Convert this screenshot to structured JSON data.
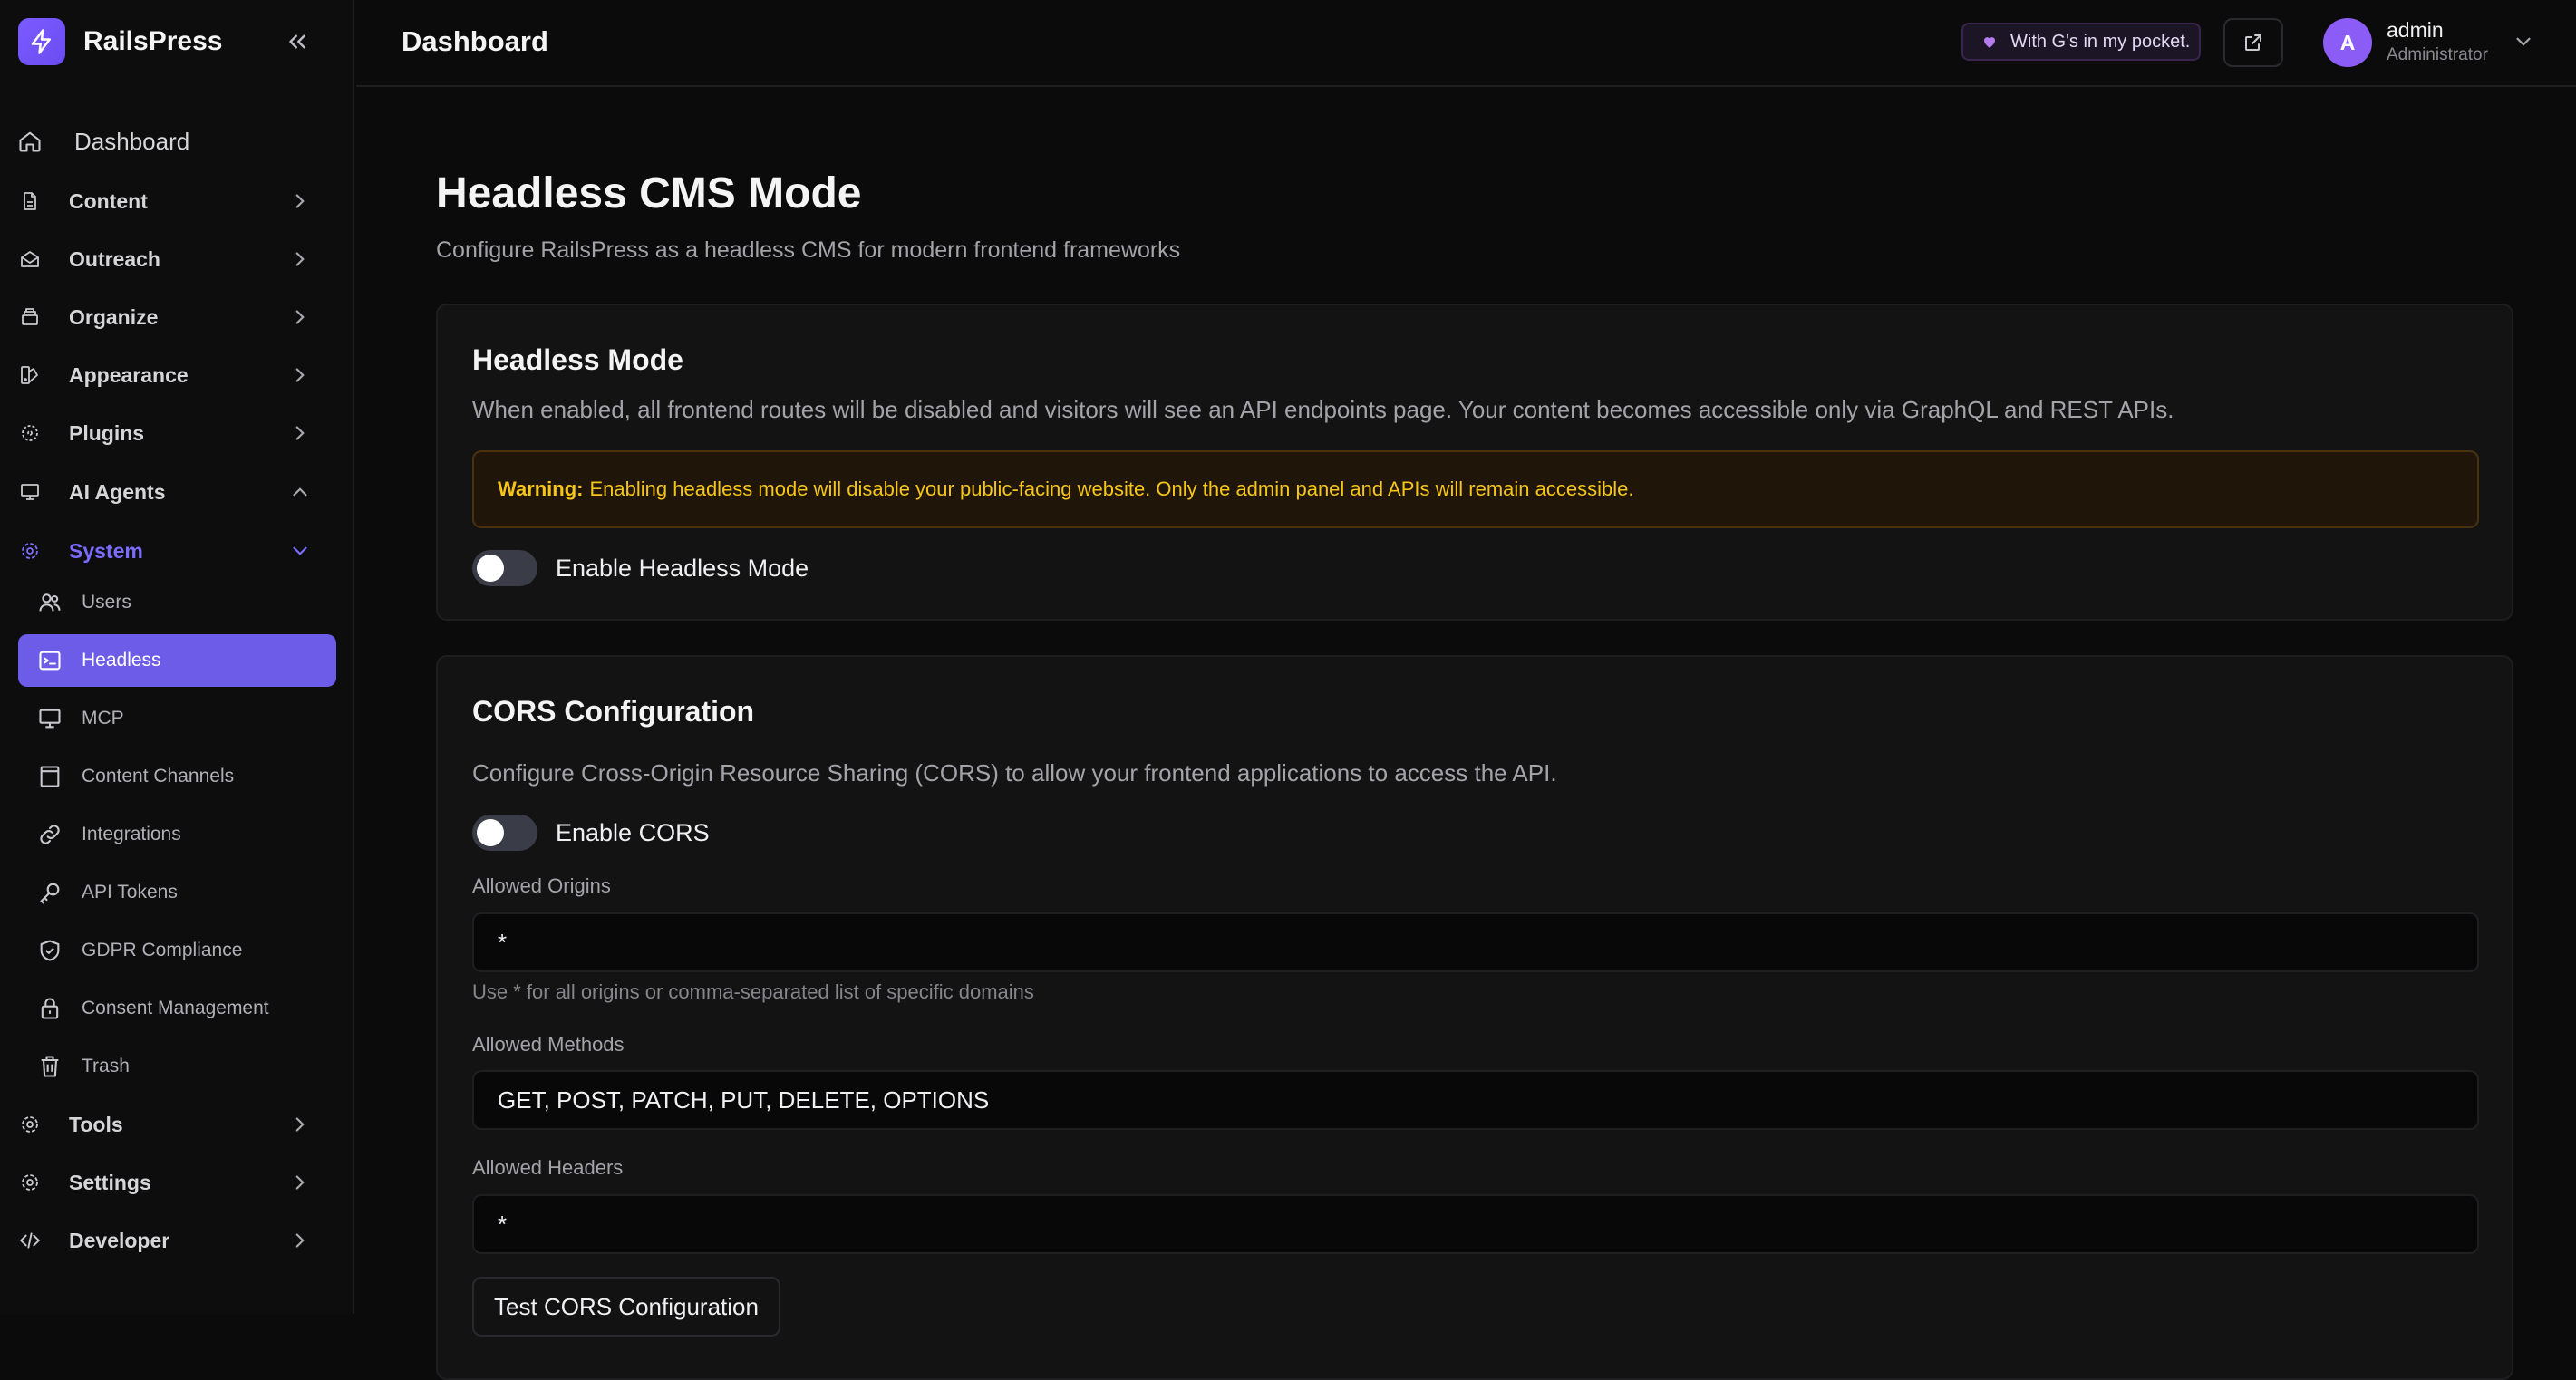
{
  "colors": {
    "accent": "#6c5ce7",
    "system_accent": "#7b6cff",
    "warning_text": "#f5c518",
    "avatar": "#8b5cf6"
  },
  "brand": {
    "name": "RailsPress",
    "logo_icon": "bolt-icon"
  },
  "sidebar": {
    "dashboard": "Dashboard",
    "items": [
      {
        "label": "Content",
        "icon": "file-icon",
        "expanded": false
      },
      {
        "label": "Outreach",
        "icon": "mail-open-icon",
        "expanded": false
      },
      {
        "label": "Organize",
        "icon": "archive-icon",
        "expanded": false
      },
      {
        "label": "Appearance",
        "icon": "swatch-icon",
        "expanded": false
      },
      {
        "label": "Plugins",
        "icon": "puzzle-icon",
        "expanded": false
      },
      {
        "label": "AI Agents",
        "icon": "monitor-icon",
        "expanded": true
      },
      {
        "label": "System",
        "icon": "gear-icon",
        "expanded": true
      },
      {
        "label": "Tools",
        "icon": "gear-icon",
        "expanded": false
      },
      {
        "label": "Settings",
        "icon": "gear-icon",
        "expanded": false
      },
      {
        "label": "Developer",
        "icon": "code-icon",
        "expanded": false
      }
    ],
    "system_children": [
      {
        "label": "Users",
        "icon": "users-icon"
      },
      {
        "label": "Headless",
        "icon": "terminal-icon",
        "active": true
      },
      {
        "label": "MCP",
        "icon": "monitor-icon"
      },
      {
        "label": "Content Channels",
        "icon": "panel-icon"
      },
      {
        "label": "Integrations",
        "icon": "link-icon"
      },
      {
        "label": "API Tokens",
        "icon": "key-icon"
      },
      {
        "label": "GDPR Compliance",
        "icon": "shield-check-icon"
      },
      {
        "label": "Consent Management",
        "icon": "lock-icon"
      },
      {
        "label": "Trash",
        "icon": "trash-icon"
      }
    ]
  },
  "header": {
    "title": "Dashboard",
    "badge": "With G's in my pocket.",
    "user": {
      "initial": "A",
      "name": "admin",
      "role": "Administrator"
    }
  },
  "main": {
    "title": "Headless CMS Mode",
    "subtitle": "Configure RailsPress as a headless CMS for modern frontend frameworks",
    "headless_card": {
      "title": "Headless Mode",
      "description": "When enabled, all frontend routes will be disabled and visitors will see an API endpoints page. Your content becomes accessible only via GraphQL and REST APIs.",
      "warning_label": "Warning:",
      "warning_text": "Enabling headless mode will disable your public-facing website. Only the admin panel and APIs will remain accessible.",
      "toggle_label": "Enable Headless Mode",
      "toggle_on": false
    },
    "cors_card": {
      "title": "CORS Configuration",
      "description": "Configure Cross-Origin Resource Sharing (CORS) to allow your frontend applications to access the API.",
      "toggle_label": "Enable CORS",
      "toggle_on": false,
      "origins_label": "Allowed Origins",
      "origins_value": "*",
      "origins_help": "Use * for all origins or comma-separated list of specific domains",
      "methods_label": "Allowed Methods",
      "methods_value": "GET, POST, PATCH, PUT, DELETE, OPTIONS",
      "headers_label": "Allowed Headers",
      "headers_value": "*",
      "test_button": "Test CORS Configuration"
    }
  }
}
